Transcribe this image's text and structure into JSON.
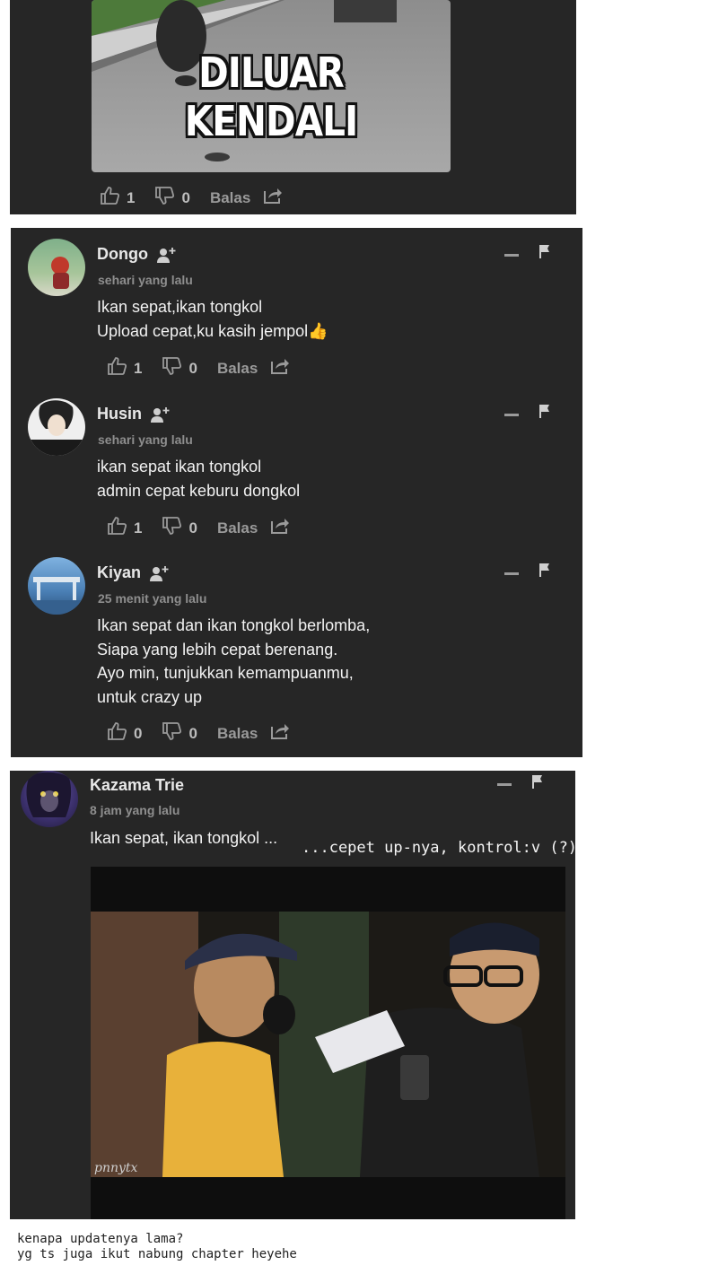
{
  "top_post": {
    "meme_caption": "DILUAR KENDALI",
    "likes": "1",
    "dislikes": "0",
    "reply_label": "Balas"
  },
  "thread": [
    {
      "author": "Dongo",
      "time": "sehari yang lalu",
      "body": "Ikan sepat,ikan tongkol\nUpload cepat,ku kasih jempol",
      "emoji": "👍",
      "likes": "1",
      "dislikes": "0",
      "reply_label": "Balas"
    },
    {
      "author": "Husin",
      "time": "sehari yang lalu",
      "body": "ikan sepat ikan tongkol\nadmin cepat keburu dongkol",
      "likes": "1",
      "dislikes": "0",
      "reply_label": "Balas"
    },
    {
      "author": "Kiyan",
      "time": "25 menit yang lalu",
      "body": "Ikan sepat dan ikan tongkol berlomba,\nSiapa yang lebih cepat berenang.\nAyo min, tunjukkan kemampuanmu,\nuntuk crazy up",
      "likes": "0",
      "dislikes": "0",
      "reply_label": "Balas"
    }
  ],
  "bottom_post": {
    "author": "Kazama Trie",
    "time": "8 jam yang lalu",
    "body": "Ikan sepat, ikan tongkol ...",
    "annotation": "...cepet up-nya, kontrol:v (?)",
    "watermark": "pnnytx"
  },
  "footnote": {
    "line1": "kenapa updatenya lama?",
    "line2": "yg ts juga ikut nabung chapter heyehe"
  },
  "colors": {
    "panel": "#262626",
    "text": "#f2f2f2",
    "muted": "#8e8e8e"
  }
}
